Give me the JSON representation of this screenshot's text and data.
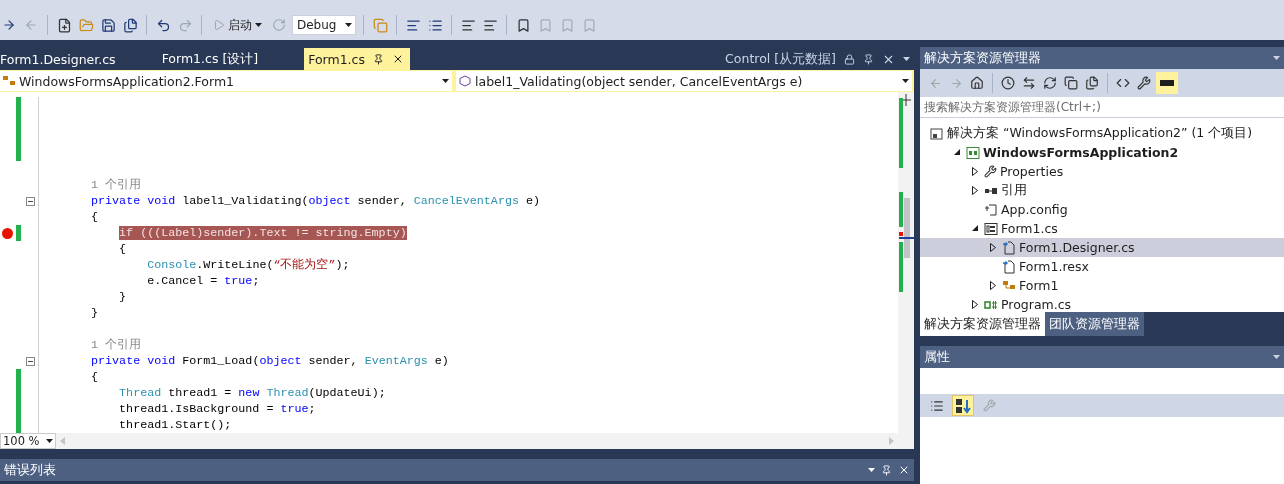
{
  "toolbar": {
    "start_button": "启动",
    "config_combo": "Debug"
  },
  "doc_tabs": [
    {
      "label": "Form1.Designer.cs",
      "selected": false
    },
    {
      "label": "Form1.cs [设计]",
      "selected": false
    },
    {
      "label": "Form1.cs",
      "selected": true
    }
  ],
  "preview_tab": {
    "label": "Control [从元数据]"
  },
  "nav_bar": {
    "type_combo": "WindowsFormsApplication2.Form1",
    "member_combo": "label1_Validating(object sender, CancelEventArgs e)"
  },
  "editor": {
    "zoom": "100 %",
    "lines": [
      {
        "kind": "blank",
        "changed": true
      },
      {
        "kind": "blank",
        "changed": true
      },
      {
        "kind": "blank",
        "changed": true
      },
      {
        "kind": "blank",
        "changed": true
      },
      {
        "kind": "blank"
      },
      {
        "kind": "lens",
        "text": "    1 个引用"
      },
      {
        "kind": "code",
        "changed": false,
        "foldable": true,
        "breakpoint": false,
        "tokens": [
          {
            "kind": "keyword",
            "text": "    private void "
          },
          {
            "kind": "plain",
            "text": "label1_Validating("
          },
          {
            "kind": "keyword",
            "text": "object"
          },
          {
            "kind": "plain",
            "text": " sender, "
          },
          {
            "kind": "type",
            "text": "CancelEventArgs"
          },
          {
            "kind": "plain",
            "text": " e)"
          }
        ]
      },
      {
        "kind": "code",
        "changed": false,
        "foldable": false,
        "breakpoint": false,
        "tokens": [
          {
            "kind": "plain",
            "text": "    {"
          }
        ]
      },
      {
        "kind": "code",
        "changed": true,
        "foldable": false,
        "breakpoint": true,
        "tokens": [
          {
            "kind": "plain",
            "text": "        if (((Label)sender).Text != string.Empty)"
          }
        ]
      },
      {
        "kind": "code",
        "changed": false,
        "foldable": false,
        "breakpoint": false,
        "tokens": [
          {
            "kind": "plain",
            "text": "        {"
          }
        ]
      },
      {
        "kind": "code",
        "changed": false,
        "foldable": false,
        "breakpoint": false,
        "tokens": [
          {
            "kind": "type",
            "text": "            Console"
          },
          {
            "kind": "plain",
            "text": ".WriteLine("
          },
          {
            "kind": "string",
            "text": "“不能为空”"
          },
          {
            "kind": "plain",
            "text": ");"
          }
        ]
      },
      {
        "kind": "code",
        "changed": false,
        "foldable": false,
        "breakpoint": false,
        "tokens": [
          {
            "kind": "plain",
            "text": "            e.Cancel = "
          },
          {
            "kind": "keyword",
            "text": "true"
          },
          {
            "kind": "plain",
            "text": ";"
          }
        ]
      },
      {
        "kind": "code",
        "changed": false,
        "foldable": false,
        "breakpoint": false,
        "tokens": [
          {
            "kind": "plain",
            "text": "        }"
          }
        ]
      },
      {
        "kind": "code",
        "changed": false,
        "foldable": false,
        "breakpoint": false,
        "tokens": [
          {
            "kind": "plain",
            "text": "    }"
          }
        ]
      },
      {
        "kind": "blank"
      },
      {
        "kind": "lens",
        "text": "    1 个引用"
      },
      {
        "kind": "code",
        "changed": false,
        "foldable": true,
        "breakpoint": false,
        "tokens": [
          {
            "kind": "keyword",
            "text": "    private void "
          },
          {
            "kind": "plain",
            "text": "Form1_Load("
          },
          {
            "kind": "keyword",
            "text": "object"
          },
          {
            "kind": "plain",
            "text": " sender, "
          },
          {
            "kind": "type",
            "text": "EventArgs"
          },
          {
            "kind": "plain",
            "text": " e)"
          }
        ]
      },
      {
        "kind": "code",
        "changed": true,
        "foldable": false,
        "breakpoint": false,
        "tokens": [
          {
            "kind": "plain",
            "text": "    {"
          }
        ]
      },
      {
        "kind": "code",
        "changed": true,
        "foldable": false,
        "breakpoint": false,
        "tokens": [
          {
            "kind": "type",
            "text": "        Thread"
          },
          {
            "kind": "plain",
            "text": " thread1 = "
          },
          {
            "kind": "keyword",
            "text": "new "
          },
          {
            "kind": "type",
            "text": "Thread"
          },
          {
            "kind": "plain",
            "text": "(UpdateUi);"
          }
        ]
      },
      {
        "kind": "code",
        "changed": true,
        "foldable": false,
        "breakpoint": false,
        "tokens": [
          {
            "kind": "plain",
            "text": "        thread1.IsBackground = "
          },
          {
            "kind": "keyword",
            "text": "true"
          },
          {
            "kind": "plain",
            "text": ";"
          }
        ]
      },
      {
        "kind": "code",
        "changed": true,
        "foldable": false,
        "breakpoint": false,
        "tokens": [
          {
            "kind": "plain",
            "text": "        thread1.Start();"
          }
        ]
      }
    ]
  },
  "error_list": {
    "title": "错误列表"
  },
  "solution_explorer": {
    "title": "解决方案资源管理器",
    "search_placeholder": "搜索解决方案资源管理器(Ctrl+;)",
    "tree": [
      {
        "label": "解决方案 “WindowsFormsApplication2” (1 个项目)",
        "kind": "solution",
        "startup": false,
        "selected": false,
        "children": [
          {
            "label": "WindowsFormsApplication2",
            "kind": "project",
            "expanded": true,
            "startup": true,
            "selected": false,
            "children": [
              {
                "label": "Properties",
                "kind": "properties",
                "expanded": false,
                "startup": false,
                "selected": false
              },
              {
                "label": "引用",
                "kind": "references",
                "expanded": false,
                "startup": false,
                "selected": false
              },
              {
                "label": "App.config",
                "kind": "config",
                "startup": false,
                "selected": false
              },
              {
                "label": "Form1.cs",
                "kind": "form",
                "expanded": true,
                "startup": false,
                "selected": false,
                "children": [
                  {
                    "label": "Form1.Designer.cs",
                    "kind": "dependent",
                    "expanded": false,
                    "startup": false,
                    "selected": true
                  },
                  {
                    "label": "Form1.resx",
                    "kind": "dependent",
                    "startup": false,
                    "selected": false
                  },
                  {
                    "label": "Form1",
                    "kind": "class",
                    "expanded": false,
                    "startup": false,
                    "selected": false
                  }
                ]
              },
              {
                "label": "Program.cs",
                "kind": "source",
                "expanded": false,
                "startup": false,
                "selected": false
              }
            ]
          }
        ]
      }
    ],
    "tabs": [
      {
        "label": "解决方案资源管理器",
        "selected": true
      },
      {
        "label": "团队资源管理器",
        "selected": false
      }
    ]
  },
  "properties": {
    "title": "属性",
    "buttons": [
      {
        "kind": "categorized",
        "selected": false
      },
      {
        "kind": "alphabetical",
        "selected": true
      },
      {
        "kind": "pages",
        "selected": false
      }
    ]
  }
}
